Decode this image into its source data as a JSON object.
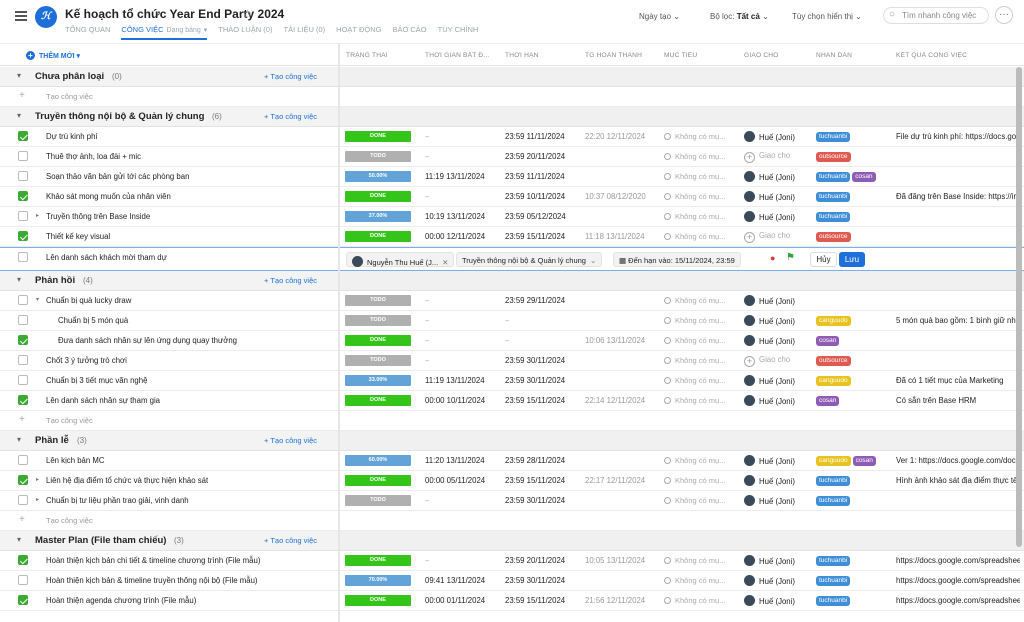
{
  "app": {
    "title": "Kế hoạch tổ chức Year End Party 2024",
    "logo_text": "ℋ"
  },
  "tabs": [
    {
      "label": "TỔNG QUAN"
    },
    {
      "label": "CÔNG VIỆC",
      "sub": "Dạng bảng",
      "active": true
    },
    {
      "label": "THẢO LUẬN (0)"
    },
    {
      "label": "TÀI LIỆU (0)"
    },
    {
      "label": "HOẠT ĐỘNG"
    },
    {
      "label": "BÁO CÁO"
    },
    {
      "label": "TÙY CHỈNH"
    }
  ],
  "toolbar": {
    "date_sort": "Ngày tạo",
    "filter_label": "Bộ lọc:",
    "filter_value": "Tất cả",
    "display_options": "Tùy chọn hiển thị",
    "search_placeholder": "Tìm nhanh công việc",
    "add_new": "THÊM MỚI"
  },
  "columns": [
    "TRẠNG THÁI",
    "THỜI GIAN BẮT Đ...",
    "THỜI HẠN",
    "TG HOÀN THÀNH",
    "MỤC TIÊU",
    "GIAO CHO",
    "NHÃN DÁN",
    "KẾT QUẢ CÔNG VIỆC"
  ],
  "labels": {
    "add_task_group": "+ Tạo công việc",
    "add_task_row": "Tạo công việc",
    "no_goal": "Không có mụ...",
    "assign_placeholder": "Giao cho",
    "empty": "–"
  },
  "tag_colors": {
    "tuchuanbi": "#3f8fd8",
    "outsource": "#e05a4f",
    "cosan": "#8f5cb5",
    "canguudo": "#e8c21e"
  },
  "status_colors": {
    "done": "#35c419",
    "todo": "#b0b0b0",
    "progress": "#62a4d8"
  },
  "edit_row": {
    "assignee": "Nguyễn Thu Huế (J...",
    "group": "Truyền thông nội bộ & Quản lý chung",
    "deadline": "Đến hạn vào: 15/11/2024, 23:59",
    "cancel": "Hủy",
    "save": "Lưu"
  },
  "rows": [
    {
      "kind": "group",
      "name": "Chưa phân loại",
      "count": "(0)"
    },
    {
      "kind": "add"
    },
    {
      "kind": "group",
      "name": "Truyền thông nội bộ & Quản lý chung",
      "count": "(6)"
    },
    {
      "kind": "task",
      "checked": true,
      "name": "Dự trù kinh phí",
      "status": "DONE",
      "st": "done",
      "start": "–",
      "deadline": "23:59 11/11/2024",
      "done_at": "22:20 12/11/2024",
      "assignee": "Huế (Joni)",
      "tags": [
        "tuchuanbi"
      ],
      "result": "File dự trù kinh phí: https://docs.goo"
    },
    {
      "kind": "task",
      "checked": false,
      "name": "Thuê thợ ảnh, loa đài + mic",
      "status": "TODO",
      "st": "todo",
      "start": "–",
      "deadline": "23:59 20/11/2024",
      "done_at": "",
      "assignee": "",
      "tags": [
        "outsource"
      ],
      "result": ""
    },
    {
      "kind": "task",
      "checked": false,
      "name": "Soạn thảo văn bản gửi tới các phòng ban",
      "status": "50.00%",
      "st": "progress",
      "start": "11:19 13/11/2024",
      "deadline": "23:59 11/11/2024",
      "done_at": "",
      "assignee": "Huế (Joni)",
      "tags": [
        "tuchuanbi",
        "cosan"
      ],
      "result": ""
    },
    {
      "kind": "task",
      "checked": true,
      "name": "Khảo sát mong muốn của nhân viên",
      "status": "DONE",
      "st": "done",
      "start": "–",
      "deadline": "23:59 10/11/2024",
      "done_at": "10:37 08/12/2020",
      "assignee": "Huế (Joni)",
      "tags": [
        "tuchuanbi"
      ],
      "result": "Đã đăng trên Base Inside: https://insi"
    },
    {
      "kind": "task",
      "checked": false,
      "caret": true,
      "name": "Truyền thông trên Base Inside",
      "status": "37.00%",
      "st": "progress",
      "start": "10:19 13/11/2024",
      "deadline": "23:59 05/12/2024",
      "done_at": "",
      "assignee": "Huế (Joni)",
      "tags": [
        "tuchuanbi"
      ],
      "result": ""
    },
    {
      "kind": "task",
      "checked": true,
      "name": "Thiết kế key visual",
      "status": "DONE",
      "st": "done",
      "start": "00:00 12/11/2024",
      "deadline": "23:59 15/11/2024",
      "done_at": "11:18 13/11/2024",
      "assignee": "",
      "tags": [
        "outsource"
      ],
      "result": ""
    },
    {
      "kind": "edit",
      "checked": false,
      "name": "Lên danh sách khách mời tham dự"
    },
    {
      "kind": "group",
      "name": "Phản hồi",
      "count": "(4)"
    },
    {
      "kind": "task",
      "checked": false,
      "caret": "down",
      "name": "Chuẩn bị quà lucky draw",
      "status": "TODO",
      "st": "todo",
      "start": "–",
      "deadline": "23:59 29/11/2024",
      "done_at": "",
      "assignee": "Huế (Joni)",
      "tags": [],
      "result": ""
    },
    {
      "kind": "task",
      "checked": false,
      "indent": true,
      "name": "Chuẩn bị 5 món quà",
      "status": "TODO",
      "st": "todo",
      "start": "–",
      "deadline": "–",
      "done_at": "",
      "assignee": "Huế (Joni)",
      "tags": [
        "canguudo"
      ],
      "result": "5 món quà bao gồm: 1 bình giữ nhiệt"
    },
    {
      "kind": "task",
      "checked": true,
      "indent": true,
      "name": "Đưa danh sách nhân sự lên ứng dụng quay thưởng",
      "status": "DONE",
      "st": "done",
      "start": "–",
      "deadline": "–",
      "done_at": "10:06 13/11/2024",
      "assignee": "Huế (Joni)",
      "tags": [
        "cosan"
      ],
      "result": ""
    },
    {
      "kind": "task",
      "checked": false,
      "name": "Chốt 3 ý tưởng trò chơi",
      "status": "TODO",
      "st": "todo",
      "start": "–",
      "deadline": "23:59 30/11/2024",
      "done_at": "",
      "assignee": "",
      "tags": [
        "outsource"
      ],
      "result": ""
    },
    {
      "kind": "task",
      "checked": false,
      "name": "Chuẩn bị 3 tiết mục văn nghệ",
      "status": "33.00%",
      "st": "progress",
      "start": "11:19 13/11/2024",
      "deadline": "23:59 30/11/2024",
      "done_at": "",
      "assignee": "Huế (Joni)",
      "tags": [
        "canguudo"
      ],
      "result": "Đã có 1 tiết mục của Marketing"
    },
    {
      "kind": "task",
      "checked": true,
      "name": "Lên danh sách nhân sự tham gia",
      "status": "DONE",
      "st": "done",
      "start": "00:00 10/11/2024",
      "deadline": "23:59 15/11/2024",
      "done_at": "22:14 12/11/2024",
      "assignee": "Huế (Joni)",
      "tags": [
        "cosan"
      ],
      "result": "Có sẵn trên Base HRM"
    },
    {
      "kind": "add"
    },
    {
      "kind": "group",
      "name": "Phần lễ",
      "count": "(3)"
    },
    {
      "kind": "task",
      "checked": false,
      "name": "Lên kịch bản MC",
      "status": "60.00%",
      "st": "progress",
      "start": "11:20 13/11/2024",
      "deadline": "23:59 28/11/2024",
      "done_at": "",
      "assignee": "Huế (Joni)",
      "tags": [
        "canguudo",
        "cosan"
      ],
      "result": "Ver 1: https://docs.google.com/docum"
    },
    {
      "kind": "task",
      "checked": true,
      "caret": true,
      "name": "Liên hệ địa điểm tổ chức và thực hiện khảo sát",
      "status": "DONE",
      "st": "done",
      "start": "00:00 05/11/2024",
      "deadline": "23:59 15/11/2024",
      "done_at": "22:17 12/11/2024",
      "assignee": "Huế (Joni)",
      "tags": [
        "tuchuanbi"
      ],
      "result": "Hình ảnh khảo sát địa điểm thực tế"
    },
    {
      "kind": "task",
      "checked": false,
      "caret": true,
      "name": "Chuẩn bị tư liệu phần trao giải, vinh danh",
      "status": "TODO",
      "st": "todo",
      "start": "–",
      "deadline": "23:59 30/11/2024",
      "done_at": "",
      "assignee": "Huế (Joni)",
      "tags": [
        "tuchuanbi"
      ],
      "result": ""
    },
    {
      "kind": "add"
    },
    {
      "kind": "group",
      "name": "Master Plan (File tham chiếu)",
      "count": "(3)"
    },
    {
      "kind": "task",
      "checked": true,
      "name": "Hoàn thiện kịch bản chi tiết & timeline chương trình (File mẫu)",
      "status": "DONE",
      "st": "done",
      "start": "–",
      "deadline": "23:59 20/11/2024",
      "done_at": "10:05 13/11/2024",
      "assignee": "Huế (Joni)",
      "tags": [
        "tuchuanbi"
      ],
      "result": "https://docs.google.com/spreadsheets"
    },
    {
      "kind": "task",
      "checked": false,
      "name": "Hoàn thiện kịch bản & timeline truyền thông nội bộ (File mẫu)",
      "status": "70.00%",
      "st": "progress",
      "start": "09:41 13/11/2024",
      "deadline": "23:59 30/11/2024",
      "done_at": "",
      "assignee": "Huế (Joni)",
      "tags": [
        "tuchuanbi"
      ],
      "result": "https://docs.google.com/spreadsheets"
    },
    {
      "kind": "task",
      "checked": true,
      "name": "Hoàn thiện agenda chương trình (File mẫu)",
      "status": "DONE",
      "st": "done",
      "start": "00:00 01/11/2024",
      "deadline": "23:59 15/11/2024",
      "done_at": "21:56 12/11/2024",
      "assignee": "Huế (Joni)",
      "tags": [
        "tuchuanbi"
      ],
      "result": "https://docs.google.com/spreadsheets"
    }
  ]
}
